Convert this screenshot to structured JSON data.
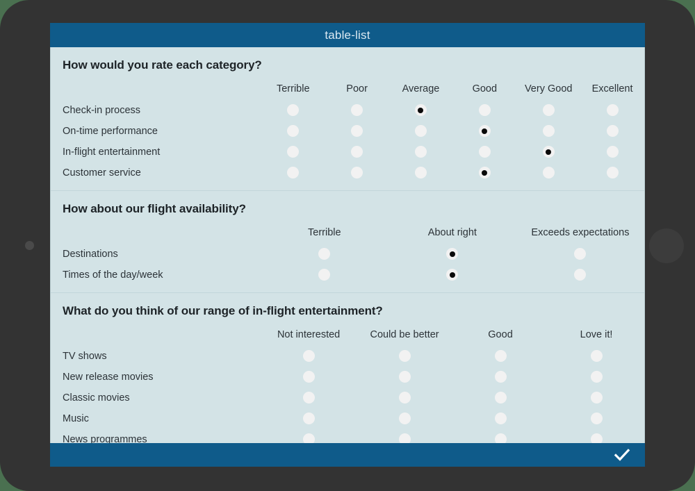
{
  "window": {
    "title": "table-list",
    "accent_color": "#0f5b8a",
    "content_bg": "#d3e3e6"
  },
  "footer": {
    "confirm_icon": "check-icon"
  },
  "device": {
    "frame_color": "#333333",
    "backdrop_color": "#4a7050",
    "camera_icon": "camera-dot",
    "home_icon": "home-button"
  },
  "questions": [
    {
      "id": "rate-each-category",
      "heading": "How would you rate each category?",
      "columns": [
        "Terrible",
        "Poor",
        "Average",
        "Good",
        "Very Good",
        "Excellent"
      ],
      "rows": [
        {
          "label": "Check-in process",
          "selected": 2
        },
        {
          "label": "On-time performance",
          "selected": 3
        },
        {
          "label": "In-flight entertainment",
          "selected": 4
        },
        {
          "label": "Customer service",
          "selected": 3
        }
      ]
    },
    {
      "id": "flight-availability",
      "heading": "How about our flight availability?",
      "columns": [
        "Terrible",
        "About right",
        "Exceeds expectations"
      ],
      "rows": [
        {
          "label": "Destinations",
          "selected": 1
        },
        {
          "label": "Times of the day/week",
          "selected": 1
        }
      ]
    },
    {
      "id": "in-flight-entertainment-range",
      "heading": "What do you think of our range of in-flight entertainment?",
      "columns": [
        "Not interested",
        "Could be better",
        "Good",
        "Love it!"
      ],
      "rows": [
        {
          "label": "TV shows",
          "selected": -1
        },
        {
          "label": "New release movies",
          "selected": -1
        },
        {
          "label": "Classic movies",
          "selected": -1
        },
        {
          "label": "Music",
          "selected": -1
        },
        {
          "label": "News programmes",
          "selected": -1
        }
      ]
    }
  ]
}
